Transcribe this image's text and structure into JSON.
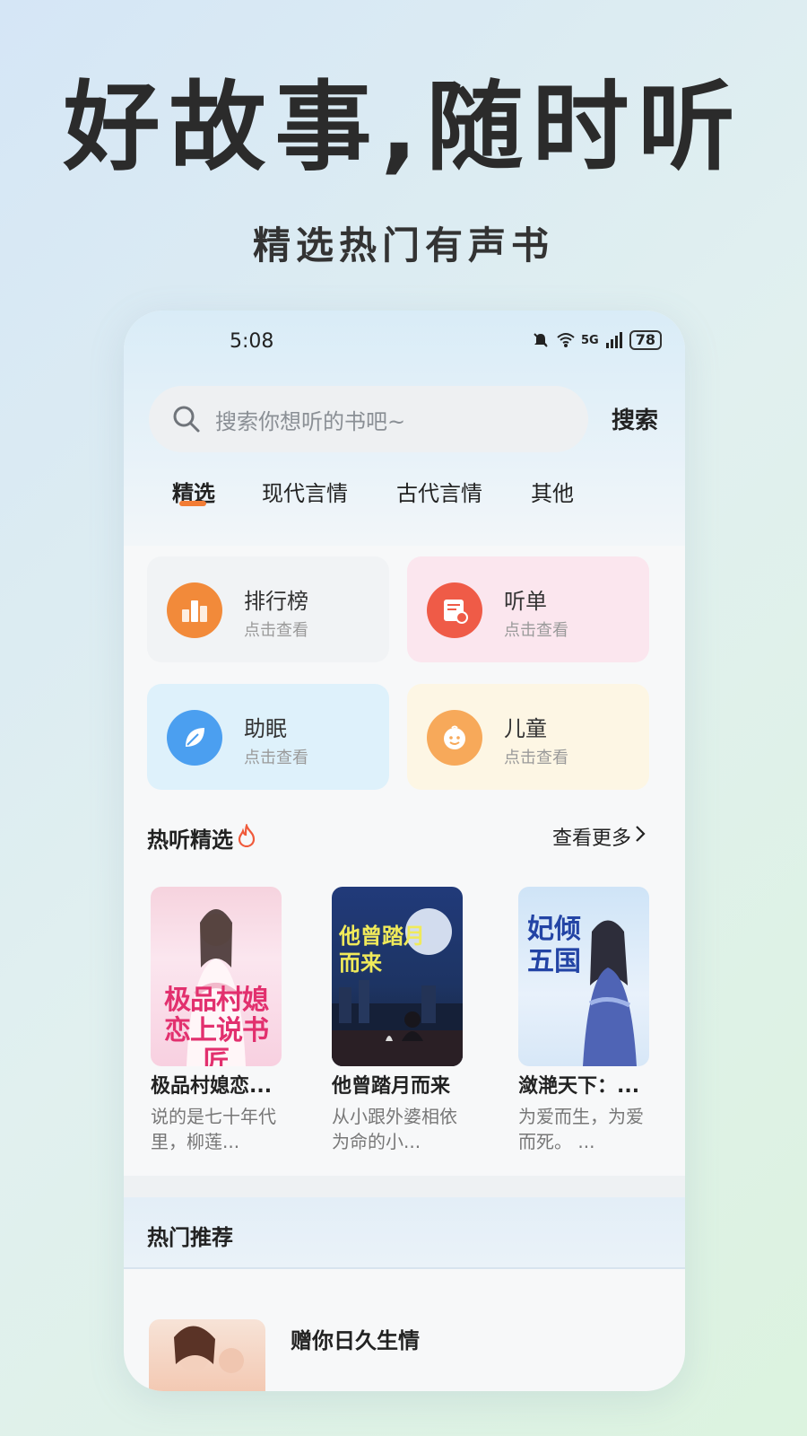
{
  "hero": {
    "title": "好故事,随时听",
    "subtitle": "精选热门有声书"
  },
  "status_bar": {
    "time": "5:08",
    "network": "5G",
    "battery": "78",
    "icons": [
      "mute-bell-icon",
      "wifi-icon",
      "signal-icon",
      "battery-icon"
    ]
  },
  "search": {
    "placeholder": "搜索你想听的书吧~",
    "button_label": "搜索"
  },
  "tabs": [
    {
      "label": "精选",
      "active": true
    },
    {
      "label": "现代言情",
      "active": false
    },
    {
      "label": "古代言情",
      "active": false
    },
    {
      "label": "其他",
      "active": false
    }
  ],
  "category_cards": [
    {
      "title": "排行榜",
      "subtitle": "点击查看",
      "icon": "ranking-icon",
      "bg": "#f1f3f5",
      "circle": "#f28a3a"
    },
    {
      "title": "听单",
      "subtitle": "点击查看",
      "icon": "playlist-icon",
      "bg": "#fbe6ee",
      "circle": "#ef5b47"
    },
    {
      "title": "助眠",
      "subtitle": "点击查看",
      "icon": "leaf-icon",
      "bg": "#def1fb",
      "circle": "#4b9ff0"
    },
    {
      "title": "儿童",
      "subtitle": "点击查看",
      "icon": "child-face-icon",
      "bg": "#fdf6e4",
      "circle": "#f7a95a"
    }
  ],
  "hot_picks": {
    "title": "热听精选",
    "icon": "fire-icon",
    "more_label": "查看更多",
    "books": [
      {
        "title": "极品村媳恋...",
        "desc": "说的是七十年代里，柳莲...",
        "cover_text": "极品村媳恋上说书匠"
      },
      {
        "title": "他曾踏月而来",
        "desc": "从小跟外婆相依为命的小...",
        "cover_text": "他曾踏月而来"
      },
      {
        "title": "潋滟天下：...",
        "desc": "为爱而生，为爱而死。 ...",
        "cover_text": "妃倾五国"
      }
    ]
  },
  "recommend": {
    "title": "热门推荐",
    "first_item_title": "赠你日久生情"
  },
  "colors": {
    "accent": "#f27c35",
    "hot_icon": "#f05a3b"
  }
}
